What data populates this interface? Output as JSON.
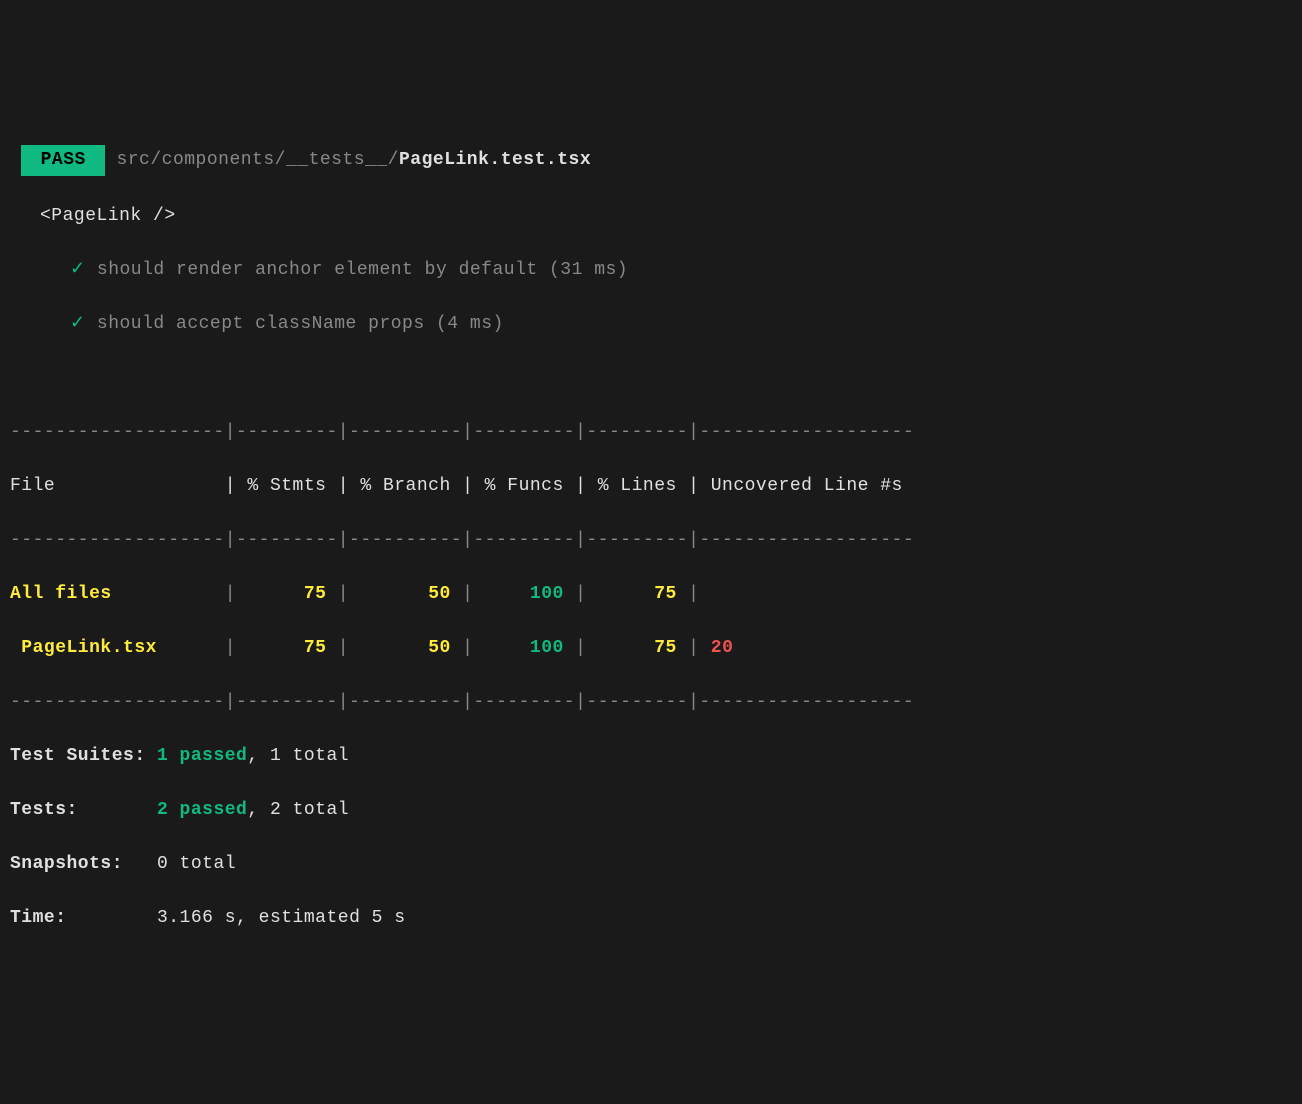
{
  "header": {
    "pass_label": " PASS ",
    "path_prefix": "src/components/__tests__/",
    "file_name": "PageLink.test.tsx"
  },
  "describe": {
    "title": "<PageLink />"
  },
  "tests": [
    {
      "name": "should render anchor element by default",
      "duration": "(31 ms)"
    },
    {
      "name": "should accept className props",
      "duration": "(4 ms)"
    }
  ],
  "coverage": {
    "divider": "-------------------|---------|----------|---------|---------|-------------------",
    "header_row": "File               | % Stmts | % Branch | % Funcs | % Lines | Uncovered Line #s ",
    "rows": [
      {
        "file": "All files",
        "file_padded": "All files         ",
        "stmts": "75",
        "branch": "50",
        "funcs": "100",
        "lines": "75",
        "uncovered": "",
        "stmts_color": "yellow",
        "branch_color": "yellow",
        "funcs_color": "green",
        "lines_color": "yellow",
        "uncovered_color": ""
      },
      {
        "file": " PageLink.tsx",
        "file_padded": " PageLink.tsx     ",
        "stmts": "75",
        "branch": "50",
        "funcs": "100",
        "lines": "75",
        "uncovered": "20",
        "stmts_color": "yellow",
        "branch_color": "yellow",
        "funcs_color": "green",
        "lines_color": "yellow",
        "uncovered_color": "red"
      }
    ]
  },
  "summary": {
    "test_suites_label": "Test Suites: ",
    "test_suites_passed": "1 passed",
    "test_suites_total": ", 1 total",
    "tests_label": "Tests:       ",
    "tests_passed": "2 passed",
    "tests_total": ", 2 total",
    "snapshots_label": "Snapshots:   ",
    "snapshots_value": "0 total",
    "time_label": "Time:        ",
    "time_value": "3.166 s, estimated 5 s"
  },
  "chart_data": {
    "type": "table",
    "title": "Jest Coverage Report",
    "columns": [
      "File",
      "% Stmts",
      "% Branch",
      "% Funcs",
      "% Lines",
      "Uncovered Line #s"
    ],
    "rows": [
      {
        "File": "All files",
        "% Stmts": 75,
        "% Branch": 50,
        "% Funcs": 100,
        "% Lines": 75,
        "Uncovered Line #s": ""
      },
      {
        "File": "PageLink.tsx",
        "% Stmts": 75,
        "% Branch": 50,
        "% Funcs": 100,
        "% Lines": 75,
        "Uncovered Line #s": "20"
      }
    ]
  }
}
